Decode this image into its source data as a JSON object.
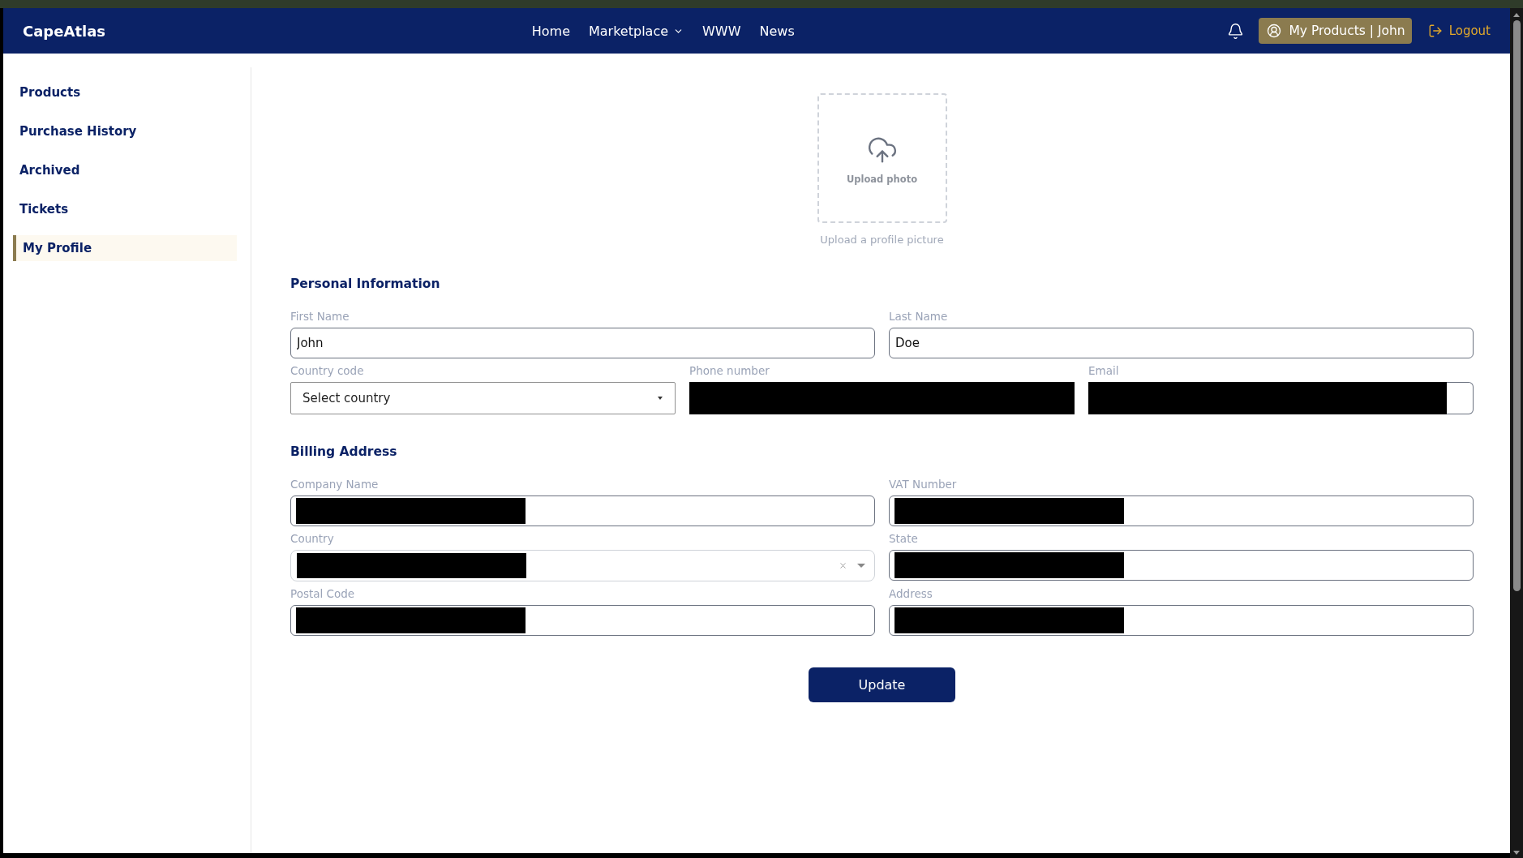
{
  "navbar": {
    "logo": "CapeAtlas",
    "links": [
      {
        "label": "Home",
        "dropdown": false
      },
      {
        "label": "Marketplace",
        "dropdown": true
      },
      {
        "label": "WWW",
        "dropdown": false
      },
      {
        "label": "News",
        "dropdown": false
      }
    ],
    "account_button": "My Products | John",
    "logout": "Logout"
  },
  "sidebar": {
    "items": [
      {
        "label": "Products",
        "selected": false
      },
      {
        "label": "Purchase History",
        "selected": false
      },
      {
        "label": "Archived",
        "selected": false
      },
      {
        "label": "Tickets",
        "selected": false
      },
      {
        "label": "My Profile",
        "selected": true
      }
    ]
  },
  "photo_upload": {
    "box_label": "Upload photo",
    "caption": "Upload a profile picture"
  },
  "sections": [
    {
      "title": "Personal Information",
      "rows": [
        {
          "fields": [
            {
              "kind": "text",
              "label": "First Name",
              "value": "John",
              "redacted": false
            },
            {
              "kind": "text",
              "label": "Last Name",
              "value": "Doe",
              "redacted": false
            }
          ]
        },
        {
          "fields": [
            {
              "kind": "select",
              "label": "Country code",
              "placeholder": "Select country",
              "redacted": false
            },
            {
              "kind": "text",
              "label": "Phone number",
              "redacted": true
            },
            {
              "kind": "text",
              "label": "Email",
              "redacted": true
            }
          ]
        }
      ]
    },
    {
      "title": "Billing Address",
      "rows": [
        {
          "fields": [
            {
              "kind": "text",
              "label": "Company Name",
              "redacted": true
            },
            {
              "kind": "text",
              "label": "VAT Number",
              "redacted": true
            }
          ]
        },
        {
          "fields": [
            {
              "kind": "combobox",
              "label": "Country",
              "redacted": true
            },
            {
              "kind": "text",
              "label": "State",
              "redacted": true
            }
          ]
        },
        {
          "fields": [
            {
              "kind": "text",
              "label": "Postal Code",
              "redacted": true
            },
            {
              "kind": "text",
              "label": "Address",
              "redacted": true
            }
          ]
        }
      ]
    }
  ],
  "submit_button": "Update"
}
